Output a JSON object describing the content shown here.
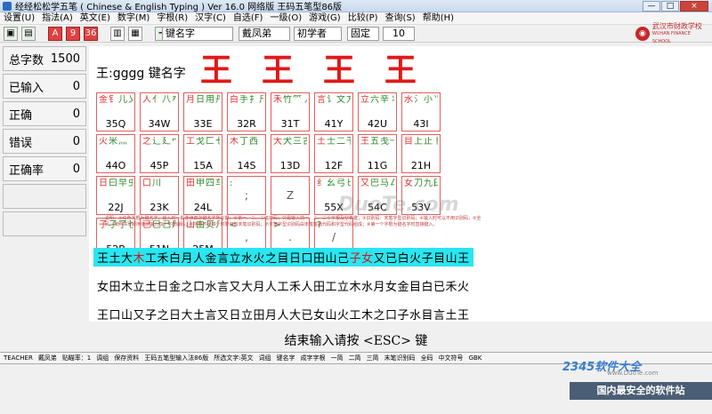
{
  "title": "经经松松学五笔 ( Chinese & English Typing ) Ver 16.0 网络版    王码五笔型86版",
  "window_buttons": [
    "—",
    "□",
    "×"
  ],
  "menu": [
    "设置(U)",
    "指法(A)",
    "英文(E)",
    "数字(M)",
    "字根(R)",
    "汉字(C)",
    "自选(F)",
    "一级(O)",
    "游戏(G)",
    "比较(P)",
    "查询(S)",
    "帮助(H)"
  ],
  "toolbar": {
    "fields": [
      "键名字",
      "戴凤弟",
      "初学者",
      "固定",
      "10"
    ],
    "buttons": [
      "A",
      "9",
      "36"
    ],
    "logo_line1": "武汉市财政学校",
    "logo_line2": "WUHAN FINANCE SCHOOL"
  },
  "stats": [
    {
      "label": "总字数",
      "value": "1500"
    },
    {
      "label": "已输入",
      "value": "0"
    },
    {
      "label": "正确",
      "value": "0"
    },
    {
      "label": "错误",
      "value": "0"
    },
    {
      "label": "正确率",
      "value": "0"
    }
  ],
  "prompt": "王:gggg  键名字",
  "big_chars": [
    "王",
    "王",
    "王",
    "王"
  ],
  "keys": [
    {
      "roots": [
        "金钅",
        "儿",
        "乂",
        "夕",
        "勺"
      ],
      "code": "35Q",
      "lead": "金"
    },
    {
      "roots": [
        "人",
        "亻",
        "八",
        "癶",
        "儿"
      ],
      "code": "34W",
      "lead": "人"
    },
    {
      "roots": [
        "月",
        "日",
        "用",
        "丹",
        "彡",
        "乃"
      ],
      "code": "33E",
      "lead": "月"
    },
    {
      "roots": [
        "白",
        "手",
        "扌",
        "斤",
        "厂",
        "丿"
      ],
      "code": "32R",
      "lead": "白"
    },
    {
      "roots": [
        "禾",
        "竹",
        "⺮",
        "丿",
        "彳",
        "攵"
      ],
      "code": "31T",
      "lead": "禾"
    },
    {
      "roots": [
        "言",
        "讠",
        "文",
        "方",
        "广",
        "圭"
      ],
      "code": "41Y",
      "lead": "言"
    },
    {
      "roots": [
        "立",
        "六",
        "辛",
        "丬",
        "疒",
        "门"
      ],
      "code": "42U",
      "lead": "立"
    },
    {
      "roots": [
        "水",
        "氵",
        "小",
        "⺌"
      ],
      "code": "43I",
      "lead": "水"
    },
    {
      "roots": [
        "火",
        "米",
        "灬"
      ],
      "code": "44O",
      "lead": "火"
    },
    {
      "roots": [
        "之",
        "辶",
        "廴",
        "冖"
      ],
      "code": "45P",
      "lead": "之"
    },
    {
      "roots": [
        "工",
        "戈",
        "匚",
        "七",
        "弋",
        "廾"
      ],
      "code": "15A",
      "lead": "工"
    },
    {
      "roots": [
        "木",
        "丁",
        "西"
      ],
      "code": "14S",
      "lead": "木"
    },
    {
      "roots": [
        "大",
        "犬",
        "三",
        "古",
        "石",
        "厂"
      ],
      "code": "13D",
      "lead": "大"
    },
    {
      "roots": [
        "土",
        "士",
        "二",
        "干",
        "寸",
        "雨"
      ],
      "code": "12F",
      "lead": "土"
    },
    {
      "roots": [
        "王",
        "五",
        "戋",
        "一"
      ],
      "code": "11G",
      "lead": "王"
    },
    {
      "roots": [
        "目",
        "上",
        "止",
        "卜",
        "虍",
        "丨"
      ],
      "code": "21H",
      "lead": "目"
    },
    {
      "roots": [
        "日",
        "曰",
        "早",
        "虫",
        "刂",
        "丨"
      ],
      "code": "22J",
      "lead": "日"
    },
    {
      "roots": [
        "口",
        "川"
      ],
      "code": "23K",
      "lead": "口"
    },
    {
      "roots": [
        "田",
        "甲",
        "四",
        "车",
        "力",
        "皿"
      ],
      "code": "24L",
      "lead": "田"
    },
    {
      "roots": [
        ":"
      ],
      "code": ";",
      "lead": ""
    },
    {
      "roots": [],
      "code": "Z",
      "lead": ""
    },
    {
      "roots": [
        "纟",
        "幺",
        "弓",
        "匕"
      ],
      "code": "55X",
      "lead": "纟"
    },
    {
      "roots": [
        "又",
        "巴",
        "马",
        "厶"
      ],
      "code": "54C",
      "lead": "又"
    },
    {
      "roots": [
        "女",
        "刀",
        "九",
        "臼",
        "彐"
      ],
      "code": "53V",
      "lead": "女"
    },
    {
      "roots": [
        "子",
        "孑",
        "了",
        "也",
        "耳",
        "卩"
      ],
      "code": "52B",
      "lead": "子"
    },
    {
      "roots": [
        "已",
        "巳",
        "己",
        "尸",
        "心",
        "羽"
      ],
      "code": "51N",
      "lead": "已"
    },
    {
      "roots": [
        "山",
        "由",
        "贝",
        "几",
        "冂"
      ],
      "code": "25M",
      "lead": "山"
    },
    {
      "roots": [
        "<"
      ],
      "code": ",",
      "lead": ""
    },
    {
      "roots": [
        ">"
      ],
      "code": ".",
      "lead": ""
    },
    {
      "roots": [
        "?"
      ],
      "code": "/",
      "lead": ""
    }
  ],
  "note": "说明：①红色字根为键名字，输入时一般连续四次键名字所在键；②第一、二、三级简码；只需输入前一、二、三个字根及空格键；③识别码：末笔字型识别码；④输入时可以不用识别码；⑤全码：按照书写顺序依次输入四个字根编码；⑥字根不足四个时要追加末笔识别码；⑦末笔字型识别码由末笔笔画代码和字型代码组成；⑧第一个字根为键名字时直接键入。",
  "lines": [
    [
      {
        "t": "王土大",
        "hl": false
      },
      {
        "t": "木",
        "hl": true
      },
      {
        "t": "工",
        "hl": false
      },
      {
        "t": "禾白月人金言立水火之目日口田山己",
        "hl": false
      },
      {
        "t": "子女",
        "hl": true
      },
      {
        "t": "又已白火子目山王",
        "hl": false
      }
    ],
    [
      {
        "t": "女田木立土日金之口水言又大月人工禾人田工立木水月女金目白已禾火",
        "hl": false
      }
    ],
    [
      {
        "t": "王口山又子之日大土言又日立田月人大已女山火工木之口子水目言土王",
        "hl": false
      }
    ]
  ],
  "end_message": "结束输入请按 <ESC> 键",
  "status": [
    "TEACHER",
    "戴凤弟",
    "贴瞄率：1",
    "调组",
    "保存资料",
    "王码五笔型输入法86版",
    "所选文字:英文",
    "词组",
    "键名字",
    "成字字根",
    "一简",
    "二简",
    "三简",
    "末笔识别码",
    "全码",
    "中文符号",
    "GBK"
  ],
  "watermark": "2345软件大全",
  "watermark_url": "www.DuoTe.com",
  "footer": "国内最安全的软件站",
  "center_watermark": "DuoTe.com",
  "colors": {
    "accent_red": "#e01818",
    "highlight": "#29e6f0",
    "root_green": "#2a8a2a"
  }
}
